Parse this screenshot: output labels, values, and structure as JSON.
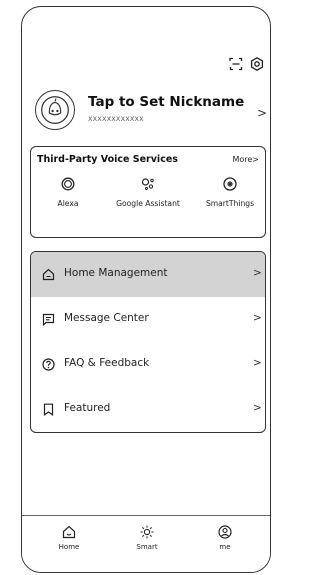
{
  "profile": {
    "nickname": "Tap to Set Nickname",
    "account_id": "XXXXXXXXXXXX",
    "chevron": ">"
  },
  "voice_services": {
    "title": "Third-Party Voice Services",
    "more_label": "More",
    "more_chevron": ">",
    "items": [
      {
        "label": "Alexa",
        "icon": "alexa-icon"
      },
      {
        "label": "Google Assistant",
        "icon": "google-assistant-icon"
      },
      {
        "label": "SmartThings",
        "icon": "smartthings-icon"
      }
    ]
  },
  "menu": {
    "items": [
      {
        "label": "Home Management",
        "icon": "home-icon",
        "chevron": ">"
      },
      {
        "label": "Message Center",
        "icon": "message-icon",
        "chevron": ">"
      },
      {
        "label": "FAQ & Feedback",
        "icon": "question-icon",
        "chevron": ">"
      },
      {
        "label": "Featured",
        "icon": "bookmark-icon",
        "chevron": ">"
      }
    ]
  },
  "tabbar": {
    "tabs": [
      {
        "label": "Home",
        "icon": "home-icon"
      },
      {
        "label": "Smart",
        "icon": "sun-icon"
      },
      {
        "label": "me",
        "icon": "profile-icon"
      }
    ]
  },
  "colors": {
    "active_row": "#d3d3d3",
    "border": "#333333"
  }
}
